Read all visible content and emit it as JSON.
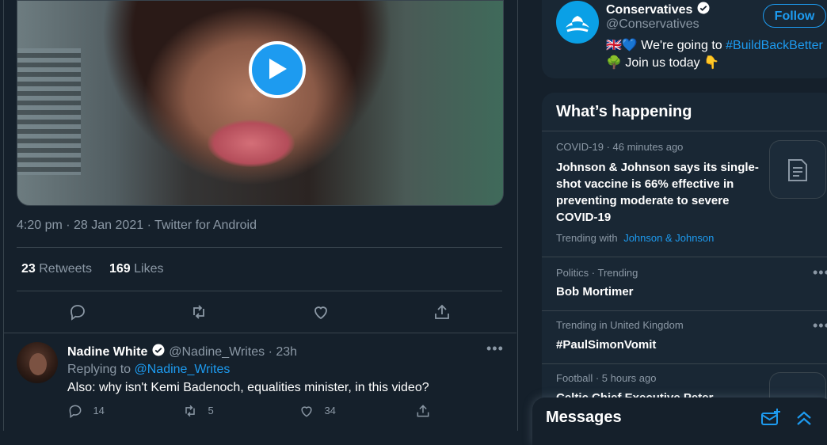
{
  "tweet": {
    "timestamp": "4:20 pm · 28 Jan 2021",
    "source": "Twitter for Android",
    "retweets_count": "23",
    "retweets_label": "Retweets",
    "likes_count": "169",
    "likes_label": "Likes"
  },
  "reply": {
    "name": "Nadine White",
    "handle": "@Nadine_Writes",
    "time": "23h",
    "replying_prefix": "Replying to",
    "replying_to": "@Nadine_Writes",
    "text": "Also: why isn't Kemi Badenoch, equalities minister, in this video?",
    "reply_count": "14",
    "retweet_count": "5",
    "like_count": "34"
  },
  "promoted": {
    "name": "Conservatives",
    "handle": "@Conservatives",
    "follow_label": "Follow",
    "line1_emoji": "🇬🇧💙",
    "line1_text": "We're going to",
    "line1_hashtag": "#BuildBackBetter",
    "line2_emoji": "🌳",
    "line2_text": "Join us today",
    "line2_emoji_end": "👇"
  },
  "whats_happening": {
    "title": "What’s happening",
    "items": [
      {
        "meta": "COVID-19 · 46 minutes ago",
        "title": "Johnson & Johnson says its single-shot vaccine is 66% effective in preventing moderate to severe COVID-19",
        "trending_with_label": "Trending with",
        "trending_with": "Johnson & Johnson"
      },
      {
        "meta": "Politics · Trending",
        "title": "Bob Mortimer"
      },
      {
        "meta": "Trending in United Kingdom",
        "title": "#PaulSimonVomit"
      },
      {
        "meta": "Football · 5 hours ago",
        "title": "Celtic Chief Executive Peter"
      }
    ]
  },
  "messages": {
    "title": "Messages"
  },
  "colors": {
    "background": "#15202b",
    "accent": "#1d9bf0",
    "muted": "#8b98a5",
    "card": "#192734",
    "border": "#38444d"
  }
}
